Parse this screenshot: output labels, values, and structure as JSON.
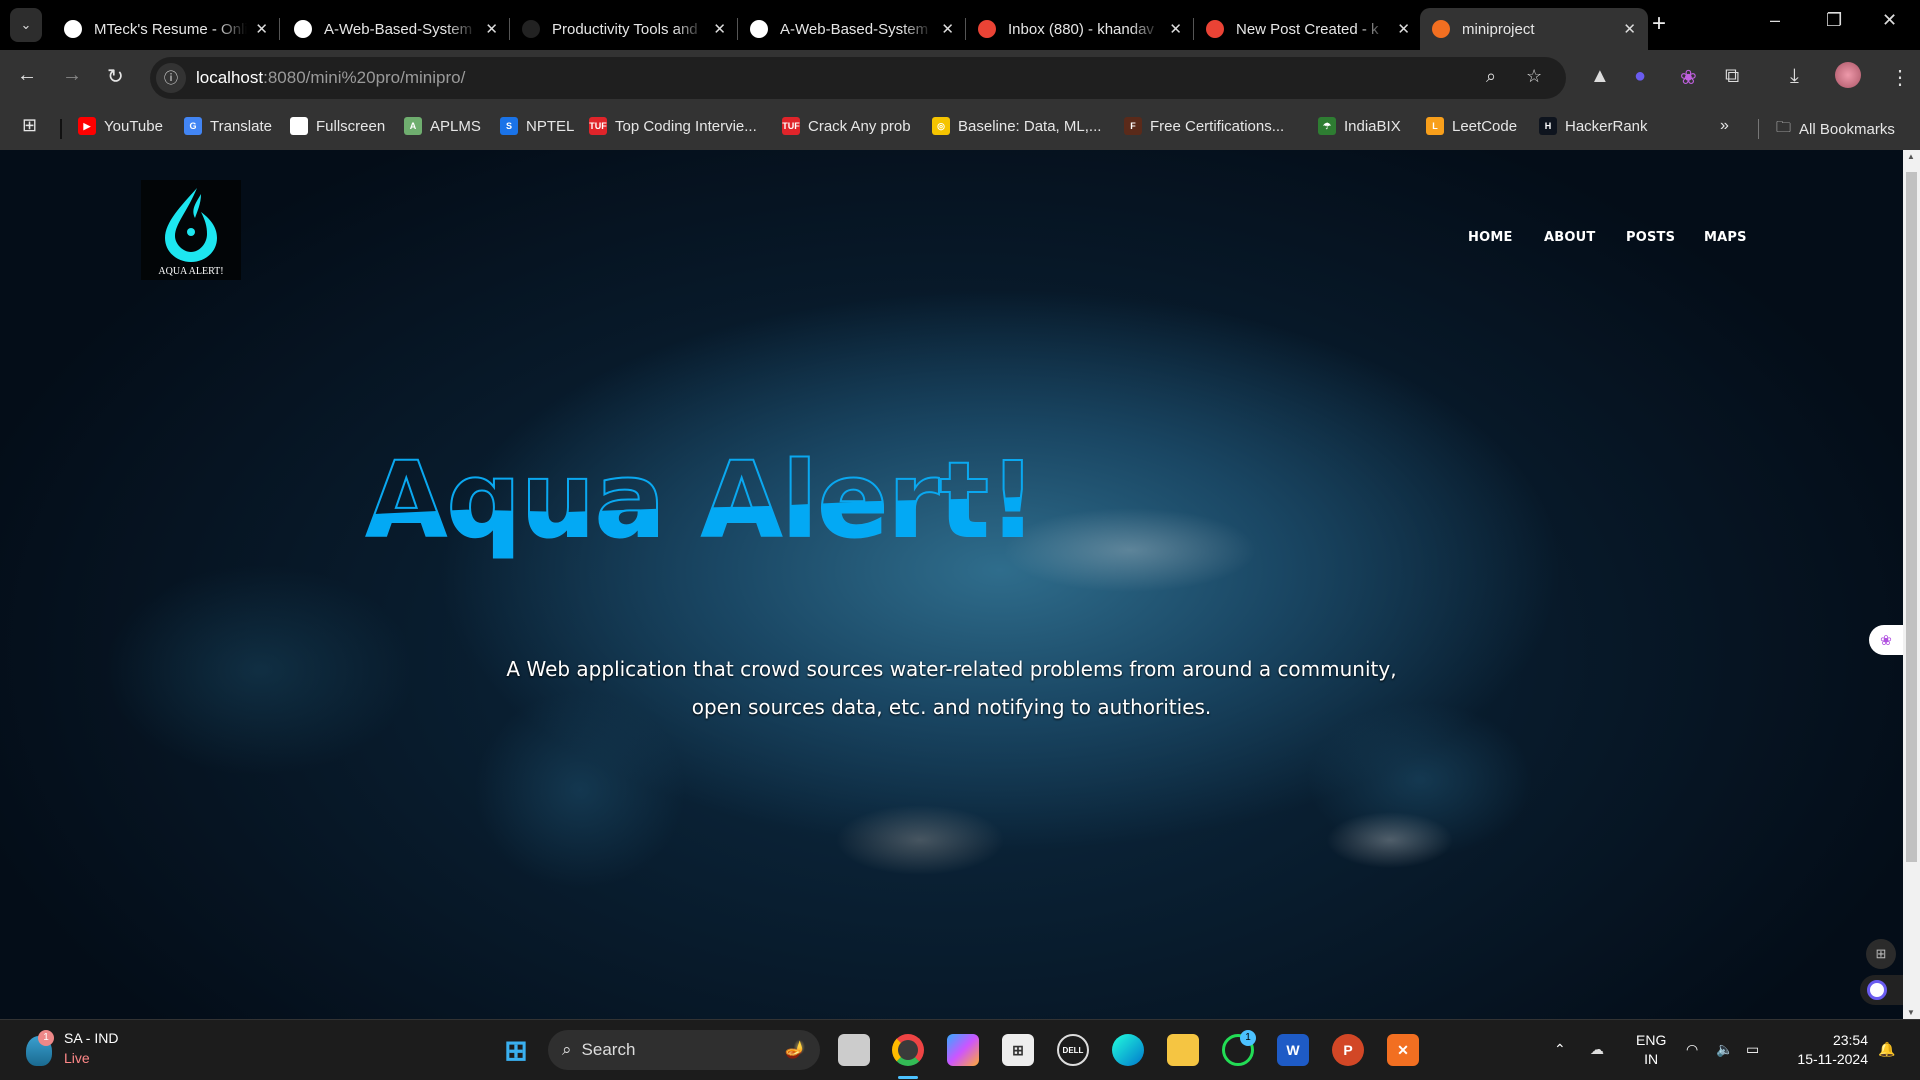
{
  "browser": {
    "tabs": [
      {
        "title": "MTeck's Resume - Online",
        "icon": "resume-icon",
        "color": "#ffffff"
      },
      {
        "title": "A-Web-Based-System",
        "icon": "github-icon",
        "color": "#ffffff"
      },
      {
        "title": "Productivity Tools and",
        "icon": "openai-icon",
        "color": "#222222"
      },
      {
        "title": "A-Web-Based-System",
        "icon": "github-icon",
        "color": "#ffffff"
      },
      {
        "title": "Inbox (880) - khandav",
        "icon": "gmail-icon",
        "color": "#ea4335"
      },
      {
        "title": "New Post Created - k",
        "icon": "gmail-icon",
        "color": "#ea4335"
      },
      {
        "title": "miniproject",
        "icon": "xampp-icon",
        "color": "#f26f21"
      }
    ],
    "url_host": "localhost",
    "url_path": ":8080/mini%20pro/minipro/",
    "bookmarks": [
      {
        "label": "YouTube",
        "color": "#ff0000",
        "glyph": "▶"
      },
      {
        "label": "Translate",
        "color": "#4285f4",
        "glyph": "G"
      },
      {
        "label": "Fullscreen",
        "color": "#ffffff",
        "glyph": "◈"
      },
      {
        "label": "APLMS",
        "color": "#6fae6f",
        "glyph": "A"
      },
      {
        "label": "NPTEL",
        "color": "#1a73e8",
        "glyph": "S"
      },
      {
        "label": "Top Coding Intervie...",
        "color": "#e0242a",
        "glyph": "TUF"
      },
      {
        "label": "Crack Any prob",
        "color": "#e0242a",
        "glyph": "TUF"
      },
      {
        "label": "Baseline: Data, ML,...",
        "color": "#f5c400",
        "glyph": "◎"
      },
      {
        "label": "Free Certifications...",
        "color": "#5a2a1a",
        "glyph": "F"
      },
      {
        "label": "IndiaBIX",
        "color": "#2e7d32",
        "glyph": "☂"
      },
      {
        "label": "LeetCode",
        "color": "#f89f1b",
        "glyph": "L"
      },
      {
        "label": "HackerRank",
        "color": "#0e141e",
        "glyph": "H"
      }
    ],
    "all_bookmarks": "All Bookmarks"
  },
  "site": {
    "logo_text": "AQUA ALERT!",
    "nav": [
      "HOME",
      "ABOUT",
      "POSTS",
      "MAPS"
    ],
    "hero_title": "Aqua Alert!",
    "subtitle_line1": "A Web application that crowd sources water-related problems from around a community,",
    "subtitle_line2": "open sources data, etc. and notifying to authorities.",
    "accent": "#03a9f4"
  },
  "taskbar": {
    "weather_badge": "1",
    "weather_title": "SA - IND",
    "weather_sub": "Live",
    "search": "Search",
    "whatsapp_badge": "1",
    "lang1": "ENG",
    "lang2": "IN",
    "time": "23:54",
    "date": "15-11-2024"
  }
}
